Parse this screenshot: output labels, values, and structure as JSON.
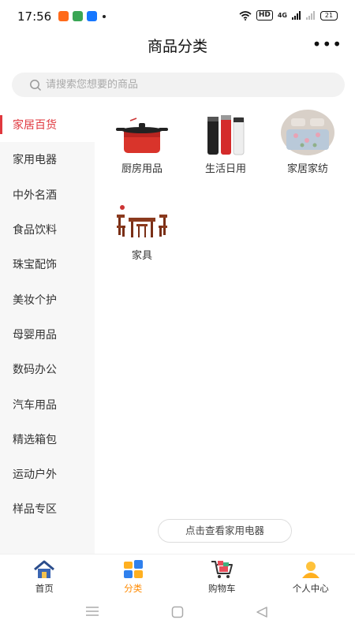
{
  "status_bar": {
    "time": "17:56",
    "app_icons": [
      "taobao-icon",
      "app-icon",
      "alipay-icon"
    ],
    "network": "HD",
    "signal": "4G",
    "battery": "21"
  },
  "header": {
    "title": "商品分类",
    "more_icon": "more-dots-icon"
  },
  "search": {
    "placeholder": "请搜索您想要的商品",
    "icon": "search-icon"
  },
  "sidebar": {
    "active_index": 0,
    "items": [
      {
        "label": "家居百货"
      },
      {
        "label": "家用电器"
      },
      {
        "label": "中外名酒"
      },
      {
        "label": "食品饮料"
      },
      {
        "label": "珠宝配饰"
      },
      {
        "label": "美妆个护"
      },
      {
        "label": "母婴用品"
      },
      {
        "label": "数码办公"
      },
      {
        "label": "汽车用品"
      },
      {
        "label": "精选箱包"
      },
      {
        "label": "运动户外"
      },
      {
        "label": "样品专区"
      }
    ]
  },
  "subcategories": [
    {
      "label": "厨房用品",
      "image": "red-pot-image"
    },
    {
      "label": "生活日用",
      "image": "thermos-bottles-image"
    },
    {
      "label": "家居家纺",
      "image": "bedding-image"
    },
    {
      "label": "家具",
      "image": "wooden-table-set-image"
    }
  ],
  "view_more": {
    "label": "点击查看家用电器"
  },
  "tab_bar": {
    "active_index": 1,
    "tabs": [
      {
        "label": "首页",
        "icon": "home-icon"
      },
      {
        "label": "分类",
        "icon": "category-icon"
      },
      {
        "label": "购物车",
        "icon": "cart-icon"
      },
      {
        "label": "个人中心",
        "icon": "user-icon"
      }
    ]
  },
  "colors": {
    "accent": "#e0383e",
    "tab_active": "#ff8a00"
  }
}
